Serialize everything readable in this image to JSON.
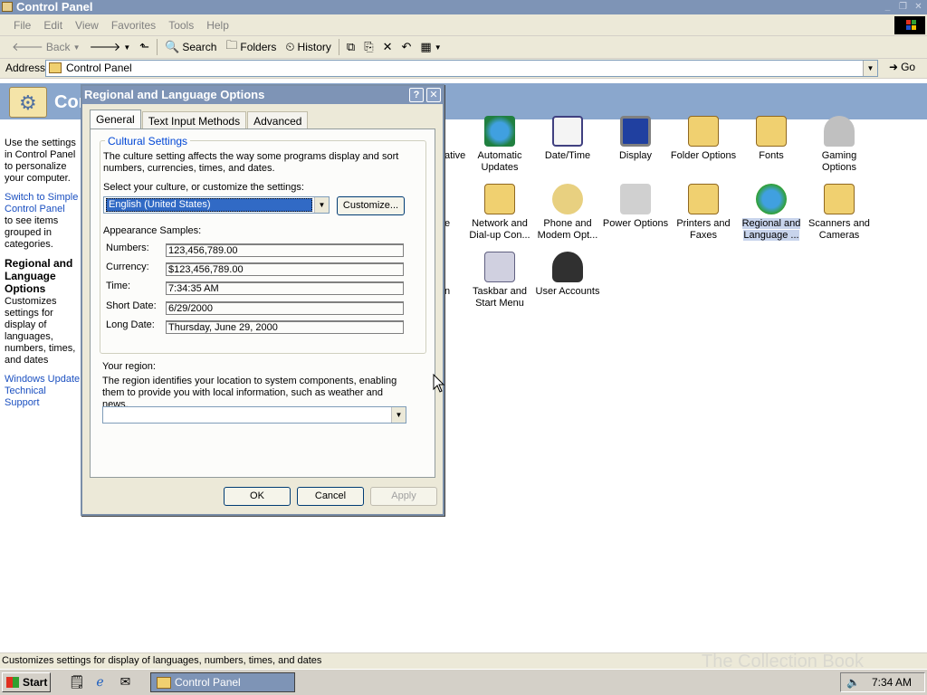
{
  "window": {
    "title": "Control Panel"
  },
  "menu": [
    "File",
    "Edit",
    "View",
    "Favorites",
    "Tools",
    "Help"
  ],
  "toolbar": {
    "back": "Back",
    "search": "Search",
    "folders": "Folders",
    "history": "History"
  },
  "address": {
    "label": "Address",
    "value": "Control Panel",
    "go": "Go"
  },
  "left_pane": {
    "header": "Control Panel",
    "intro": "Use the settings in Control Panel to personalize your computer.",
    "switch_link": "Switch to Simple Control Panel",
    "switch_desc": "to see items grouped in categories.",
    "selected_title": "Regional and Language Options",
    "selected_desc": "Customizes settings for display of languages, numbers, times, and dates",
    "link_windows_update": "Windows Update",
    "link_tech_support": "Technical Support"
  },
  "icons": {
    "automatic_updates": "Automatic Updates",
    "date_time": "Date/Time",
    "display": "Display",
    "folder_options": "Folder Options",
    "fonts": "Fonts",
    "gaming_options": "Gaming Options",
    "network": "Network and Dial-up Con...",
    "phone_modem": "Phone and Modem Opt...",
    "power": "Power Options",
    "printers": "Printers and Faxes",
    "regional": "Regional and Language ...",
    "scanners": "Scanners and Cameras",
    "taskbar": "Taskbar and Start Menu",
    "user_accounts": "User Accounts",
    "partial_admin": "ative",
    "partial_e": "e",
    "partial_n": "n"
  },
  "dialog": {
    "title": "Regional and Language Options",
    "help": "?",
    "close": "✕",
    "tabs": [
      "General",
      "Text Input Methods",
      "Advanced"
    ],
    "group_title": "Cultural Settings",
    "description": "The culture setting affects the way some programs display and sort numbers, currencies, times, and dates.",
    "select_label": "Select your culture, or customize the settings:",
    "culture_value": "English (United States)",
    "customize": "Customize...",
    "samples_heading": "Appearance Samples:",
    "samples": [
      {
        "label": "Numbers:",
        "value": "123,456,789.00"
      },
      {
        "label": "Currency:",
        "value": "$123,456,789.00"
      },
      {
        "label": "Time:",
        "value": "7:34:35 AM"
      },
      {
        "label": "Short Date:",
        "value": "6/29/2000"
      },
      {
        "label": "Long Date:",
        "value": "Thursday, June 29, 2000"
      }
    ],
    "region_heading": "Your region:",
    "region_desc": "The region identifies your location to system components, enabling them to provide you with local information, such as weather and news.",
    "region_value": "",
    "ok": "OK",
    "cancel": "Cancel",
    "apply": "Apply"
  },
  "status": "Customizes settings for display of languages, numbers, times, and dates",
  "taskbar": {
    "start": "Start",
    "task": "Control Panel",
    "clock": "7:34 AM"
  },
  "watermark": "The Collection Book"
}
